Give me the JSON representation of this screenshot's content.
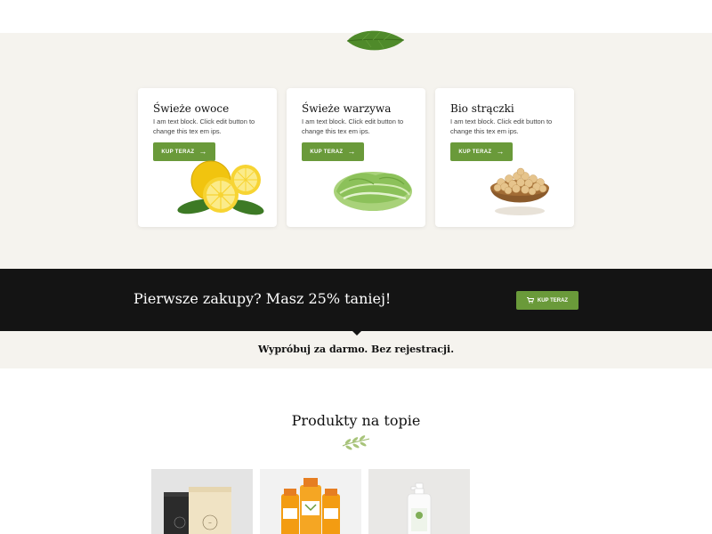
{
  "cards": [
    {
      "title": "Świeże owoce",
      "text": "I am text block. Click edit button to change this tex em ips.",
      "button": "KUP TERAZ",
      "image": "lemons"
    },
    {
      "title": "Świeże warzywa",
      "text": "I am text block. Click edit button to change this tex em ips.",
      "button": "KUP TERAZ",
      "image": "lettuce"
    },
    {
      "title": "Bio strączki",
      "text": "I am text block. Click edit button to change this tex em ips.",
      "button": "KUP TERAZ",
      "image": "chickpeas-bowl"
    }
  ],
  "promo": {
    "title": "Pierwsze zakupy? Masz 25% taniej!",
    "button": "KUP TERAZ",
    "button_icon": "cart-icon"
  },
  "trial": {
    "text": "Wypróbuj za darmo. Bez rejestracji."
  },
  "featured": {
    "title": "Produkty na topie",
    "products": [
      {
        "image": "coffee-bags"
      },
      {
        "image": "juice-bottles"
      },
      {
        "image": "lotion-bottle"
      }
    ]
  },
  "colors": {
    "accent": "#6a9a3a",
    "beige": "#f5f3ee",
    "dark": "#141414"
  }
}
